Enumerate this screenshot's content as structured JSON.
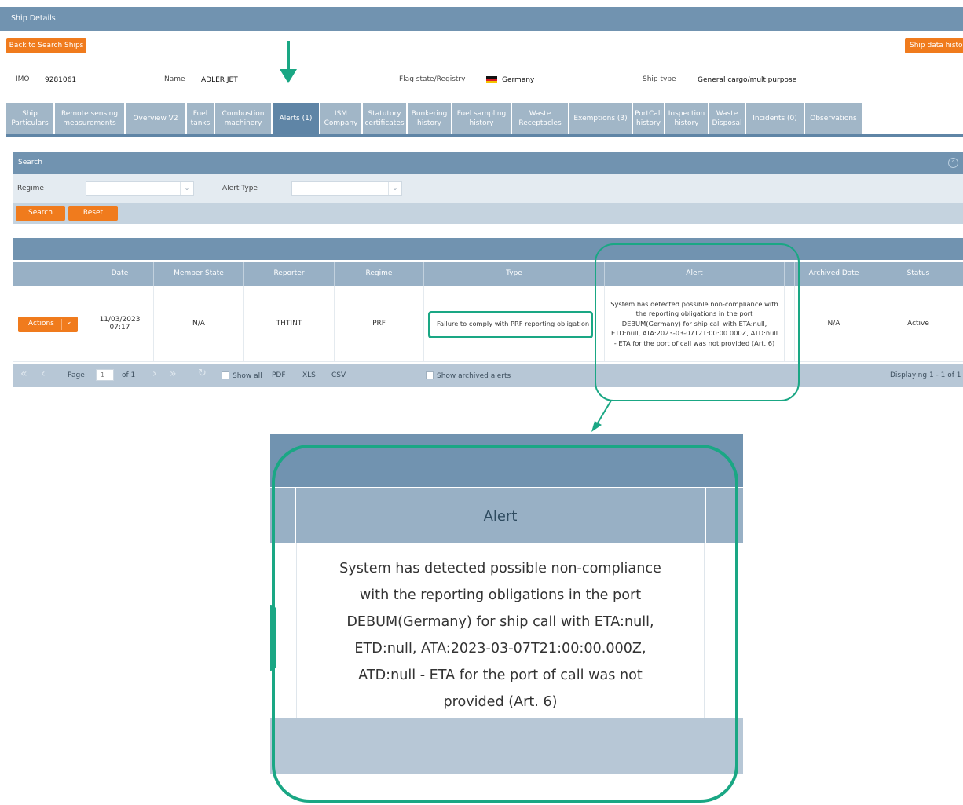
{
  "header": {
    "title": "Ship Details"
  },
  "buttons": {
    "back": "Back to Search Ships",
    "history": "Ship data history"
  },
  "ship": {
    "imo_label": "IMO",
    "imo": "9281061",
    "name_label": "Name",
    "name": "ADLER JET",
    "flag_label": "Flag state/Registry",
    "flag": "Germany",
    "type_label": "Ship type",
    "type": "General cargo/multipurpose"
  },
  "tabs": [
    {
      "label": "Ship Particulars"
    },
    {
      "label": "Remote sensing measurements"
    },
    {
      "label": "Overview V2"
    },
    {
      "label": "Fuel tanks"
    },
    {
      "label": "Combustion machinery"
    },
    {
      "label": "Alerts (1)"
    },
    {
      "label": "ISM Company"
    },
    {
      "label": "Statutory certificates"
    },
    {
      "label": "Bunkering history"
    },
    {
      "label": "Fuel sampling history"
    },
    {
      "label": "Waste Receptacles"
    },
    {
      "label": "Exemptions (3)"
    },
    {
      "label": "PortCall history"
    },
    {
      "label": "Inspection history"
    },
    {
      "label": "Waste Disposal"
    },
    {
      "label": "Incidents (0)"
    },
    {
      "label": "Observations"
    }
  ],
  "search": {
    "title": "Search",
    "regime_label": "Regime",
    "regime_value": "",
    "alert_type_label": "Alert Type",
    "alert_type_value": "",
    "search_button": "Search",
    "reset_button": "Reset"
  },
  "grid": {
    "columns": [
      "",
      "Date",
      "Member State",
      "Reporter",
      "Regime",
      "Type",
      "Alert",
      "",
      "Archived Date",
      "Status"
    ],
    "row": {
      "actions": "Actions",
      "date_line1": "11/03/2023",
      "date_line2": "07:17",
      "member_state": "N/A",
      "reporter": "THTINT",
      "regime": "PRF",
      "type": "Failure to comply with PRF reporting obligation",
      "alert": "System has detected possible non-compliance with the reporting obligations in the port DEBUM(Germany) for ship call with ETA:null, ETD:null, ATA:2023-03-07T21:00:00.000Z, ATD:null - ETA for the port of call was not provided (Art. 6)",
      "archived_date": "N/A",
      "status": "Active"
    }
  },
  "pager": {
    "page_label": "Page",
    "page_value": "1",
    "of_label": "of 1",
    "show_all": "Show all",
    "pdf": "PDF",
    "xls": "XLS",
    "csv": "CSV",
    "show_archived": "Show archived alerts",
    "displaying": "Displaying 1 - 1 of 1"
  },
  "zoom": {
    "header": "Alert",
    "lines": [
      "System has detected possible non-compliance",
      "with the reporting obligations in the port",
      "DEBUM(Germany) for ship call with ETA:null,",
      "ETD:null, ATA:2023-03-07T21:00:00.000Z,",
      "ATD:null - ETA for the port of call was not",
      "provided (Art. 6)"
    ]
  },
  "colors": {
    "accent": "#f07b1d",
    "header": "#7193b0",
    "highlight": "#1aa784"
  }
}
